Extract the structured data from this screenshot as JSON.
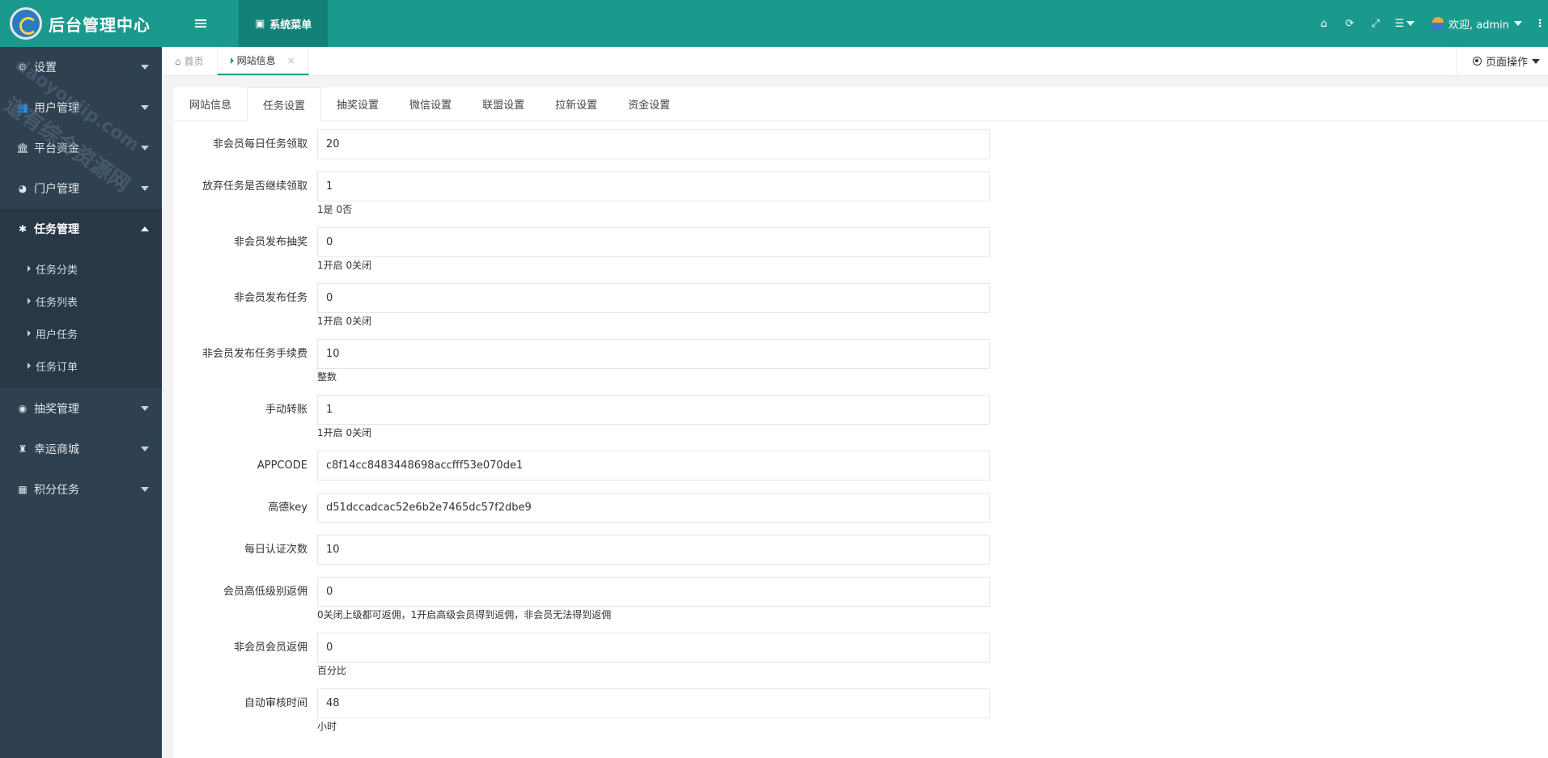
{
  "app": {
    "title": "后台管理中心"
  },
  "sidebar": {
    "items": [
      {
        "label": "设置",
        "icon": "gears-icon",
        "glyph": "⚙"
      },
      {
        "label": "用户管理",
        "icon": "users-icon",
        "glyph": "👥"
      },
      {
        "label": "平台资金",
        "icon": "bank-icon",
        "glyph": "🏛"
      },
      {
        "label": "门户管理",
        "icon": "globe-icon",
        "glyph": "◕"
      },
      {
        "label": "任务管理",
        "icon": "bug-icon",
        "glyph": "✱"
      },
      {
        "label": "抽奖管理",
        "icon": "compass-icon",
        "glyph": "◉"
      },
      {
        "label": "幸运商城",
        "icon": "shop-icon",
        "glyph": "♜"
      },
      {
        "label": "积分任务",
        "icon": "grid-icon",
        "glyph": "▦"
      }
    ],
    "submenu": [
      "任务分类",
      "任务列表",
      "用户任务",
      "任务订单"
    ]
  },
  "topbar": {
    "system_menu": "系统菜单",
    "welcome": "欢迎, admin",
    "icons": {
      "home": "⌂",
      "refresh": "⟳",
      "fullscreen": "⤢",
      "menu": "☰",
      "more": "⋮"
    }
  },
  "pagetabs": {
    "home": "首页",
    "home_glyph": "⌂",
    "current": "网站信息",
    "close": "×",
    "page_ops": "页面操作"
  },
  "content_tabs": [
    "网站信息",
    "任务设置",
    "抽奖设置",
    "微信设置",
    "联盟设置",
    "拉新设置",
    "资金设置"
  ],
  "form": {
    "fields": [
      {
        "label": "非会员每日任务领取",
        "value": "20",
        "hint": ""
      },
      {
        "label": "放弃任务是否继续领取",
        "value": "1",
        "hint": "1是 0否"
      },
      {
        "label": "非会员发布抽奖",
        "value": "0",
        "hint": "1开启 0关闭"
      },
      {
        "label": "非会员发布任务",
        "value": "0",
        "hint": "1开启 0关闭"
      },
      {
        "label": "非会员发布任务手续费",
        "value": "10",
        "hint": "整数"
      },
      {
        "label": "手动转账",
        "value": "1",
        "hint": "1开启 0关闭"
      },
      {
        "label": "APPCODE",
        "value": "c8f14cc8483448698accfff53e070de1",
        "hint": ""
      },
      {
        "label": "高德key",
        "value": "d51dccadcac52e6b2e7465dc57f2dbe9",
        "hint": ""
      },
      {
        "label": "每日认证次数",
        "value": "10",
        "hint": ""
      },
      {
        "label": "会员高低级别返佣",
        "value": "0",
        "hint": "0关闭上级都可返佣，1开启高级会员得到返佣，非会员无法得到返佣"
      },
      {
        "label": "非会员会员返佣",
        "value": "0",
        "hint": "百分比"
      },
      {
        "label": "自动审核时间",
        "value": "48",
        "hint": "小时"
      }
    ]
  },
  "watermark": {
    "line1": "道有综合资源网",
    "line2": "daoyoujip.com"
  },
  "colors": {
    "accent": "#1a9a8c",
    "sidebar_bg": "#2f4050",
    "sidebar_active": "#293846"
  }
}
